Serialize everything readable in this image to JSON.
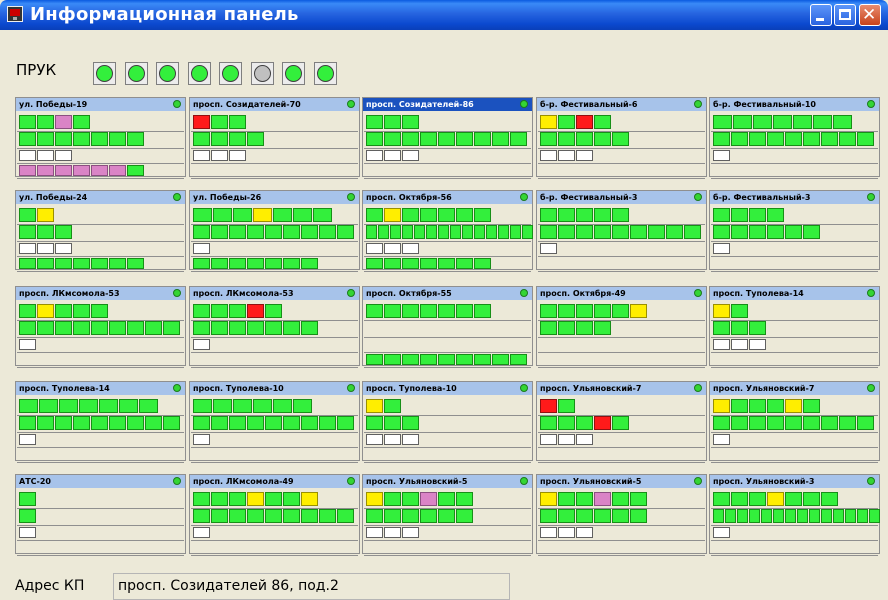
{
  "window": {
    "title": "Информационная панель"
  },
  "status_bar": {
    "label": "ПРУК",
    "indicators": [
      "ok",
      "ok",
      "ok",
      "ok",
      "ok",
      "inactive",
      "ok",
      "ok"
    ]
  },
  "colors": {
    "ok": "#33ef3c",
    "warning": "#ffee00",
    "alarm": "#ff1a1a",
    "service": "#da84c6",
    "empty": "#ffffff",
    "inactive": "#c0c0c0",
    "selected": "#1b52bf"
  },
  "panels": [
    {
      "name": "ул. Победы-19",
      "selected": false,
      "rows": [
        {
          "w": 18,
          "cells": "ggpg"
        },
        {
          "w": 18,
          "cells": "ggggggg"
        },
        {
          "w": 18,
          "cells": "www"
        },
        {
          "w": 18,
          "cells": "ppppppg"
        }
      ]
    },
    {
      "name": "просп. Созидателей-70",
      "selected": false,
      "rows": [
        {
          "w": 18,
          "cells": "rgg"
        },
        {
          "w": 18,
          "cells": "gggg"
        },
        {
          "w": 18,
          "cells": "www"
        },
        {
          "w": 18,
          "cells": ""
        }
      ]
    },
    {
      "name": "просп. Созидателей-86",
      "selected": true,
      "rows": [
        {
          "w": 18,
          "cells": "ggg"
        },
        {
          "w": 18,
          "cells": "ggggggggg"
        },
        {
          "w": 18,
          "cells": "www"
        },
        {
          "w": 18,
          "cells": ""
        }
      ]
    },
    {
      "name": "б-р. Фестивальный-6",
      "selected": false,
      "rows": [
        {
          "w": 18,
          "cells": "ygrg"
        },
        {
          "w": 18,
          "cells": "ggggg"
        },
        {
          "w": 18,
          "cells": "www"
        },
        {
          "w": 18,
          "cells": ""
        }
      ]
    },
    {
      "name": "б-р. Фестивальный-10",
      "selected": false,
      "rows": [
        {
          "w": 20,
          "cells": "ggggggg"
        },
        {
          "w": 18,
          "cells": "ggggggggg"
        },
        {
          "w": 18,
          "cells": "w"
        },
        {
          "w": 18,
          "cells": ""
        }
      ]
    },
    {
      "name": "ул. Победы-24",
      "selected": false,
      "rows": [
        {
          "w": 18,
          "cells": "gy"
        },
        {
          "w": 18,
          "cells": "ggg"
        },
        {
          "w": 18,
          "cells": "www"
        },
        {
          "w": 18,
          "cells": "ggggggg"
        }
      ]
    },
    {
      "name": "ул. Победы-26",
      "selected": false,
      "rows": [
        {
          "w": 20,
          "cells": "gggyggg"
        },
        {
          "w": 18,
          "cells": "ggggggggg"
        },
        {
          "w": 18,
          "cells": "w"
        },
        {
          "w": 18,
          "cells": "ggggggg"
        }
      ]
    },
    {
      "name": "просп. Октября-56",
      "selected": false,
      "rows": [
        {
          "w": 18,
          "cells": "gyggggg"
        },
        {
          "w": 12,
          "cells": "gggggggggggggg"
        },
        {
          "w": 18,
          "cells": "www"
        },
        {
          "w": 18,
          "cells": "ggggggg"
        }
      ]
    },
    {
      "name": "б-р. Фестивальный-3",
      "selected": false,
      "rows": [
        {
          "w": 18,
          "cells": "ggggg"
        },
        {
          "w": 18,
          "cells": "ggggggggg"
        },
        {
          "w": 18,
          "cells": "w"
        },
        {
          "w": 18,
          "cells": ""
        }
      ]
    },
    {
      "name": "б-р. Фестивальный-3",
      "selected": false,
      "rows": [
        {
          "w": 18,
          "cells": "gggg"
        },
        {
          "w": 18,
          "cells": "gggggg"
        },
        {
          "w": 18,
          "cells": "w"
        },
        {
          "w": 18,
          "cells": ""
        }
      ]
    },
    {
      "name": "просп. ЛКмсомола-53",
      "selected": false,
      "rows": [
        {
          "w": 18,
          "cells": "gyggg"
        },
        {
          "w": 18,
          "cells": "ggggggggg"
        },
        {
          "w": 18,
          "cells": "w"
        },
        {
          "w": 18,
          "cells": ""
        }
      ]
    },
    {
      "name": "просп. ЛКмсомола-53",
      "selected": false,
      "rows": [
        {
          "w": 18,
          "cells": "gggrg"
        },
        {
          "w": 18,
          "cells": "ggggggg"
        },
        {
          "w": 18,
          "cells": "w"
        },
        {
          "w": 18,
          "cells": ""
        }
      ]
    },
    {
      "name": "просп. Октября-55",
      "selected": false,
      "rows": [
        {
          "w": 18,
          "cells": "ggggggg"
        },
        {
          "w": 18,
          "cells": ""
        },
        {
          "w": 18,
          "cells": ""
        },
        {
          "w": 18,
          "cells": "ggggggggg"
        }
      ]
    },
    {
      "name": "просп. Октября-49",
      "selected": false,
      "rows": [
        {
          "w": 18,
          "cells": "gggggy"
        },
        {
          "w": 18,
          "cells": "gggg"
        },
        {
          "w": 18,
          "cells": ""
        },
        {
          "w": 18,
          "cells": ""
        }
      ]
    },
    {
      "name": "просп. Туполева-14",
      "selected": false,
      "rows": [
        {
          "w": 18,
          "cells": "yg"
        },
        {
          "w": 18,
          "cells": "ggg"
        },
        {
          "w": 18,
          "cells": "www"
        },
        {
          "w": 18,
          "cells": ""
        }
      ]
    },
    {
      "name": "просп. Туполева-14",
      "selected": false,
      "rows": [
        {
          "w": 20,
          "cells": "ggggggg"
        },
        {
          "w": 18,
          "cells": "ggggggggg"
        },
        {
          "w": 18,
          "cells": "w"
        },
        {
          "w": 18,
          "cells": ""
        }
      ]
    },
    {
      "name": "просп. Туполева-10",
      "selected": false,
      "rows": [
        {
          "w": 20,
          "cells": "gggggg"
        },
        {
          "w": 18,
          "cells": "ggggggggg"
        },
        {
          "w": 18,
          "cells": "w"
        },
        {
          "w": 18,
          "cells": ""
        }
      ]
    },
    {
      "name": "просп. Туполева-10",
      "selected": false,
      "rows": [
        {
          "w": 18,
          "cells": "yg"
        },
        {
          "w": 18,
          "cells": "ggg"
        },
        {
          "w": 18,
          "cells": "www"
        },
        {
          "w": 18,
          "cells": ""
        }
      ]
    },
    {
      "name": "просп. Ульяновский-7",
      "selected": false,
      "rows": [
        {
          "w": 18,
          "cells": "rg"
        },
        {
          "w": 18,
          "cells": "gggrg"
        },
        {
          "w": 18,
          "cells": "www"
        },
        {
          "w": 18,
          "cells": ""
        }
      ]
    },
    {
      "name": "просп. Ульяновский-7",
      "selected": false,
      "rows": [
        {
          "w": 18,
          "cells": "ygggyg"
        },
        {
          "w": 18,
          "cells": "ggggggggg"
        },
        {
          "w": 18,
          "cells": "w"
        },
        {
          "w": 18,
          "cells": ""
        }
      ]
    },
    {
      "name": "АТС-20",
      "selected": false,
      "rows": [
        {
          "w": 18,
          "cells": "g"
        },
        {
          "w": 18,
          "cells": "g"
        },
        {
          "w": 18,
          "cells": "w"
        },
        {
          "w": 18,
          "cells": ""
        }
      ]
    },
    {
      "name": "просп. ЛКмсомола-49",
      "selected": false,
      "rows": [
        {
          "w": 18,
          "cells": "gggyggy"
        },
        {
          "w": 18,
          "cells": "ggggggggg"
        },
        {
          "w": 18,
          "cells": "w"
        },
        {
          "w": 18,
          "cells": ""
        }
      ]
    },
    {
      "name": "просп. Ульяновский-5",
      "selected": false,
      "rows": [
        {
          "w": 18,
          "cells": "yggpgg"
        },
        {
          "w": 18,
          "cells": "gggggg"
        },
        {
          "w": 18,
          "cells": "www"
        },
        {
          "w": 18,
          "cells": ""
        }
      ]
    },
    {
      "name": "просп. Ульяновский-5",
      "selected": false,
      "rows": [
        {
          "w": 18,
          "cells": "yggpgg"
        },
        {
          "w": 18,
          "cells": "gggggg"
        },
        {
          "w": 18,
          "cells": "www"
        },
        {
          "w": 18,
          "cells": ""
        }
      ]
    },
    {
      "name": "просп. Ульяновский-3",
      "selected": false,
      "rows": [
        {
          "w": 18,
          "cells": "gggyggg"
        },
        {
          "w": 12,
          "cells": "gggggggggggggg"
        },
        {
          "w": 18,
          "cells": "w"
        },
        {
          "w": 18,
          "cells": ""
        }
      ]
    }
  ],
  "address_field": {
    "label": "Адрес КП",
    "value": "просп. Созидателей 86, под.2"
  }
}
